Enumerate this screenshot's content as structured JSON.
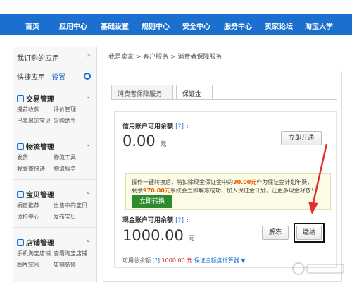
{
  "nav": {
    "items": [
      "首页",
      "应用中心",
      "基础设置",
      "规则中心",
      "安全中心",
      "服务中心",
      "卖家论坛",
      "淘宝大学"
    ]
  },
  "sidebar": {
    "my_apps": "我订购的应用",
    "quick_apps": "快捷应用",
    "quick_settings": "设置",
    "sections": [
      {
        "title": "交易管理",
        "links": [
          "提前收款",
          "评价管理",
          "已卖出的宝贝",
          "采购助手"
        ]
      },
      {
        "title": "物流管理",
        "links": [
          "发货",
          "物流工具",
          "我要寄快递",
          "物流服务"
        ]
      },
      {
        "title": "宝贝管理",
        "links": [
          "橱窗推荐",
          "出售中的宝贝",
          "体检中心",
          "发布宝贝"
        ]
      },
      {
        "title": "店铺管理",
        "links": [
          "手机淘宝店铺",
          "查看淘宝店铺",
          "图片空间",
          "店铺装修"
        ]
      }
    ]
  },
  "breadcrumb": "我是卖家 > 客户服务 > 消费者保障服务",
  "tabs": [
    "消费者保障服务",
    "保证金"
  ],
  "credit": {
    "label": "信用账户可用余额",
    "help": "[?]",
    "amount": "0.00",
    "unit": "元",
    "button": "立即开通"
  },
  "notice": {
    "line1_a": "操作一键转换后，将扣除现金保证金中的",
    "line1_b": "30.00元",
    "line1_c": "作为保证金计划年费，",
    "line2_a": "剩余",
    "line2_b": "970.00元",
    "line2_c": "系统会立即解冻成功，加入保证金计划，让更多现金释放！",
    "button": "立即转换"
  },
  "cash": {
    "label": "现金账户可用余额",
    "help": "[?]",
    "amount": "1000.00",
    "unit": "元",
    "unfreeze": "解冻",
    "pay": "缴纳"
  },
  "footer": {
    "label": "可用总余额",
    "help": "[?]",
    "value": "1000.00 元",
    "link": "保证金额度计算器"
  },
  "colors": {
    "nav_blue": "#1a6fcf",
    "convert_green": "#2e8a2e",
    "arrow_red": "#e03030",
    "amount_orange": "#e65a00"
  }
}
